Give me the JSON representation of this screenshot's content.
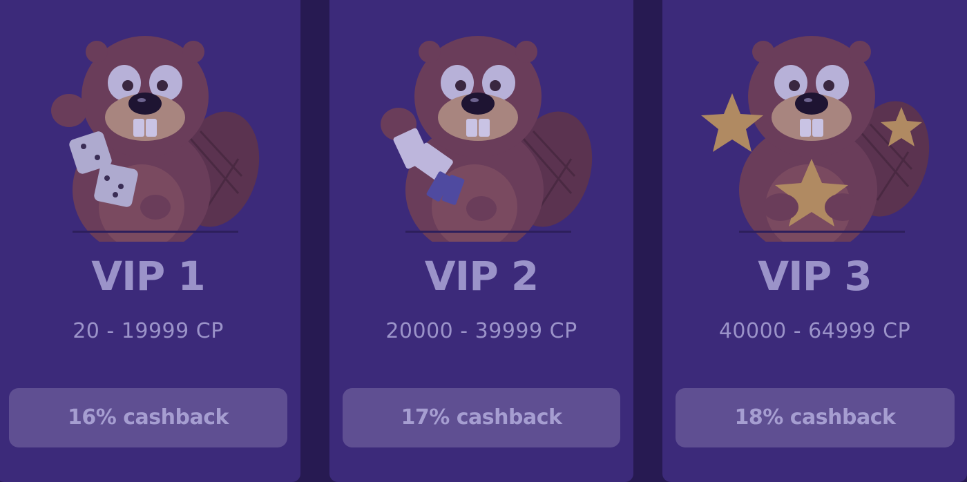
{
  "tiers": [
    {
      "title": "VIP 1",
      "range": "20 - 19999 CP",
      "cashback": "16% cashback",
      "mascot_prop": "dice"
    },
    {
      "title": "VIP 2",
      "range": "20000 - 39999 CP",
      "cashback": "17% cashback",
      "mascot_prop": "playing-cards"
    },
    {
      "title": "VIP 3",
      "range": "40000 - 64999 CP",
      "cashback": "18% cashback",
      "mascot_prop": "stars"
    }
  ],
  "colors": {
    "background": "#271a52",
    "card": "#3c2a7a",
    "text": "#9b93c9",
    "button": "#5f4f92"
  }
}
